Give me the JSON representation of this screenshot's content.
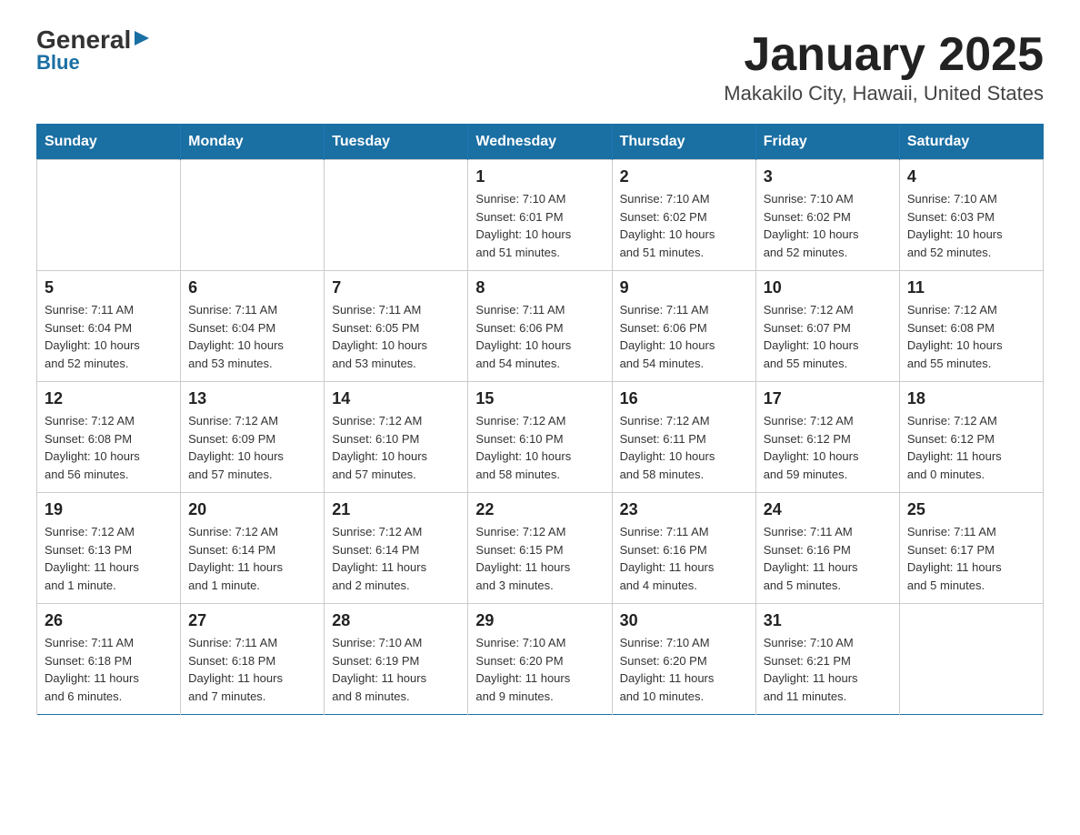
{
  "header": {
    "logo_general": "General",
    "logo_blue": "Blue",
    "title": "January 2025",
    "subtitle": "Makakilo City, Hawaii, United States"
  },
  "weekdays": [
    "Sunday",
    "Monday",
    "Tuesday",
    "Wednesday",
    "Thursday",
    "Friday",
    "Saturday"
  ],
  "weeks": [
    [
      {
        "day": "",
        "info": ""
      },
      {
        "day": "",
        "info": ""
      },
      {
        "day": "",
        "info": ""
      },
      {
        "day": "1",
        "info": "Sunrise: 7:10 AM\nSunset: 6:01 PM\nDaylight: 10 hours\nand 51 minutes."
      },
      {
        "day": "2",
        "info": "Sunrise: 7:10 AM\nSunset: 6:02 PM\nDaylight: 10 hours\nand 51 minutes."
      },
      {
        "day": "3",
        "info": "Sunrise: 7:10 AM\nSunset: 6:02 PM\nDaylight: 10 hours\nand 52 minutes."
      },
      {
        "day": "4",
        "info": "Sunrise: 7:10 AM\nSunset: 6:03 PM\nDaylight: 10 hours\nand 52 minutes."
      }
    ],
    [
      {
        "day": "5",
        "info": "Sunrise: 7:11 AM\nSunset: 6:04 PM\nDaylight: 10 hours\nand 52 minutes."
      },
      {
        "day": "6",
        "info": "Sunrise: 7:11 AM\nSunset: 6:04 PM\nDaylight: 10 hours\nand 53 minutes."
      },
      {
        "day": "7",
        "info": "Sunrise: 7:11 AM\nSunset: 6:05 PM\nDaylight: 10 hours\nand 53 minutes."
      },
      {
        "day": "8",
        "info": "Sunrise: 7:11 AM\nSunset: 6:06 PM\nDaylight: 10 hours\nand 54 minutes."
      },
      {
        "day": "9",
        "info": "Sunrise: 7:11 AM\nSunset: 6:06 PM\nDaylight: 10 hours\nand 54 minutes."
      },
      {
        "day": "10",
        "info": "Sunrise: 7:12 AM\nSunset: 6:07 PM\nDaylight: 10 hours\nand 55 minutes."
      },
      {
        "day": "11",
        "info": "Sunrise: 7:12 AM\nSunset: 6:08 PM\nDaylight: 10 hours\nand 55 minutes."
      }
    ],
    [
      {
        "day": "12",
        "info": "Sunrise: 7:12 AM\nSunset: 6:08 PM\nDaylight: 10 hours\nand 56 minutes."
      },
      {
        "day": "13",
        "info": "Sunrise: 7:12 AM\nSunset: 6:09 PM\nDaylight: 10 hours\nand 57 minutes."
      },
      {
        "day": "14",
        "info": "Sunrise: 7:12 AM\nSunset: 6:10 PM\nDaylight: 10 hours\nand 57 minutes."
      },
      {
        "day": "15",
        "info": "Sunrise: 7:12 AM\nSunset: 6:10 PM\nDaylight: 10 hours\nand 58 minutes."
      },
      {
        "day": "16",
        "info": "Sunrise: 7:12 AM\nSunset: 6:11 PM\nDaylight: 10 hours\nand 58 minutes."
      },
      {
        "day": "17",
        "info": "Sunrise: 7:12 AM\nSunset: 6:12 PM\nDaylight: 10 hours\nand 59 minutes."
      },
      {
        "day": "18",
        "info": "Sunrise: 7:12 AM\nSunset: 6:12 PM\nDaylight: 11 hours\nand 0 minutes."
      }
    ],
    [
      {
        "day": "19",
        "info": "Sunrise: 7:12 AM\nSunset: 6:13 PM\nDaylight: 11 hours\nand 1 minute."
      },
      {
        "day": "20",
        "info": "Sunrise: 7:12 AM\nSunset: 6:14 PM\nDaylight: 11 hours\nand 1 minute."
      },
      {
        "day": "21",
        "info": "Sunrise: 7:12 AM\nSunset: 6:14 PM\nDaylight: 11 hours\nand 2 minutes."
      },
      {
        "day": "22",
        "info": "Sunrise: 7:12 AM\nSunset: 6:15 PM\nDaylight: 11 hours\nand 3 minutes."
      },
      {
        "day": "23",
        "info": "Sunrise: 7:11 AM\nSunset: 6:16 PM\nDaylight: 11 hours\nand 4 minutes."
      },
      {
        "day": "24",
        "info": "Sunrise: 7:11 AM\nSunset: 6:16 PM\nDaylight: 11 hours\nand 5 minutes."
      },
      {
        "day": "25",
        "info": "Sunrise: 7:11 AM\nSunset: 6:17 PM\nDaylight: 11 hours\nand 5 minutes."
      }
    ],
    [
      {
        "day": "26",
        "info": "Sunrise: 7:11 AM\nSunset: 6:18 PM\nDaylight: 11 hours\nand 6 minutes."
      },
      {
        "day": "27",
        "info": "Sunrise: 7:11 AM\nSunset: 6:18 PM\nDaylight: 11 hours\nand 7 minutes."
      },
      {
        "day": "28",
        "info": "Sunrise: 7:10 AM\nSunset: 6:19 PM\nDaylight: 11 hours\nand 8 minutes."
      },
      {
        "day": "29",
        "info": "Sunrise: 7:10 AM\nSunset: 6:20 PM\nDaylight: 11 hours\nand 9 minutes."
      },
      {
        "day": "30",
        "info": "Sunrise: 7:10 AM\nSunset: 6:20 PM\nDaylight: 11 hours\nand 10 minutes."
      },
      {
        "day": "31",
        "info": "Sunrise: 7:10 AM\nSunset: 6:21 PM\nDaylight: 11 hours\nand 11 minutes."
      },
      {
        "day": "",
        "info": ""
      }
    ]
  ]
}
